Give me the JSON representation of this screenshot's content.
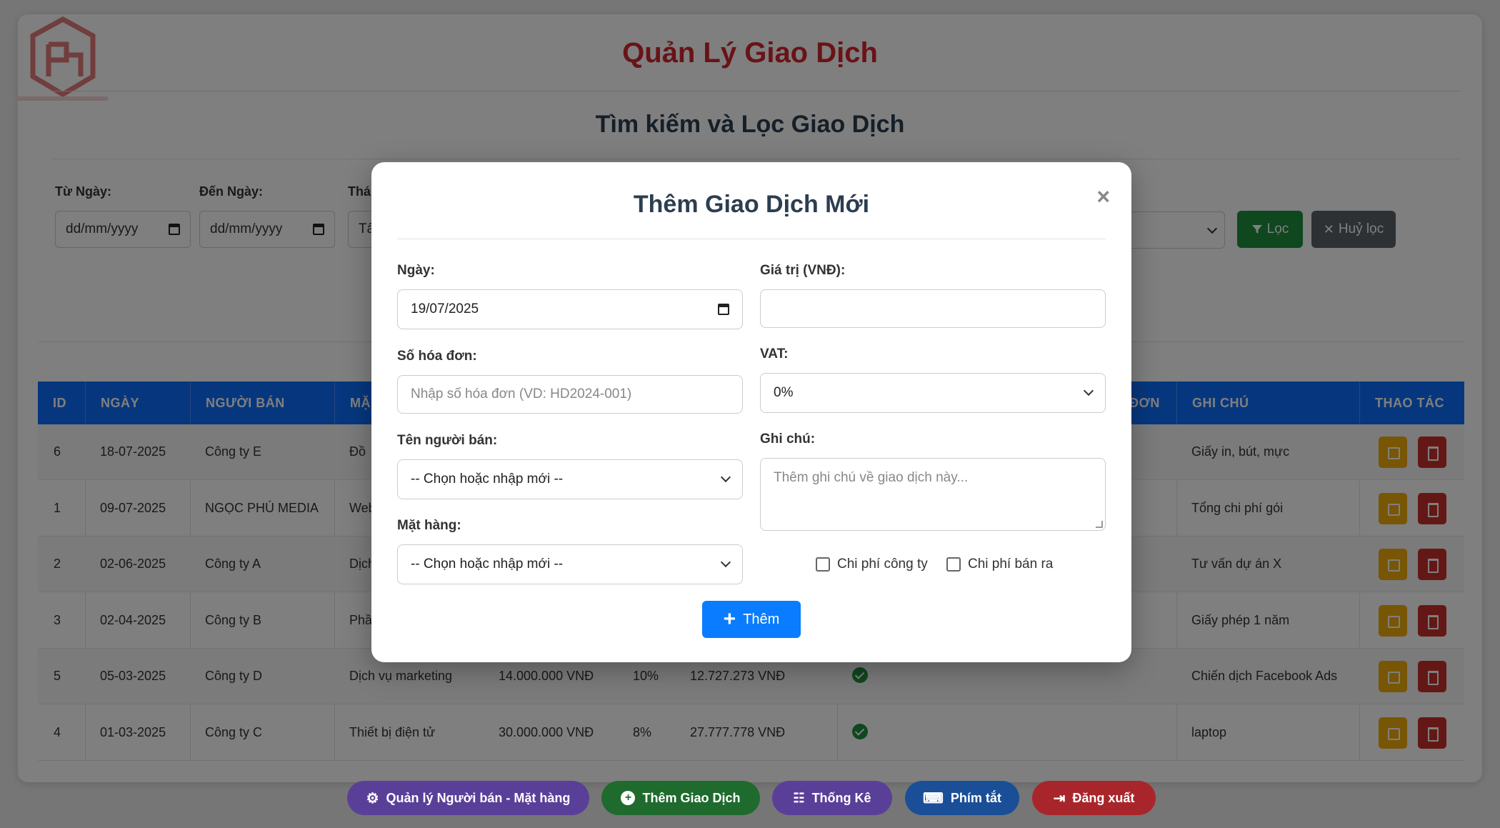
{
  "app": {
    "title": "Quản Lý Giao Dịch"
  },
  "filter": {
    "title": "Tìm kiếm và Lọc Giao Dịch",
    "from_label": "Từ Ngày:",
    "from_value": "dd/mm/yyyy",
    "to_label": "Đến Ngày:",
    "to_value": "dd/mm/yyyy",
    "third_label": "Thá",
    "third_value": "Tấ",
    "filter_button": "Lọc",
    "clear_button": "Huỷ lọc"
  },
  "table": {
    "headers": [
      "ID",
      "NGÀY",
      "NGƯỜI BÁN",
      "MẶ",
      "ĐƠN",
      "GHI CHÚ",
      "THAO TÁC"
    ],
    "rows": [
      {
        "id": "6",
        "date": "18-07-2025",
        "seller": "Công ty E",
        "item": "Đồ",
        "price": "",
        "vat": "",
        "net": "",
        "checked": false,
        "note": "Giấy in, bút, mực"
      },
      {
        "id": "1",
        "date": "09-07-2025",
        "seller": "NGỌC PHÚ MEDIA",
        "item": "Web",
        "price": "",
        "vat": "",
        "net": "",
        "checked": false,
        "note": "Tổng chi phí gói"
      },
      {
        "id": "2",
        "date": "02-06-2025",
        "seller": "Công ty A",
        "item": "Dịch",
        "price": "",
        "vat": "",
        "net": "",
        "checked": false,
        "note": "Tư vấn dự án X"
      },
      {
        "id": "3",
        "date": "02-04-2025",
        "seller": "Công ty B",
        "item": "Phầ",
        "price": "",
        "vat": "",
        "net": "",
        "checked": false,
        "note": "Giấy phép 1 năm"
      },
      {
        "id": "5",
        "date": "05-03-2025",
        "seller": "Công ty D",
        "item": "Dịch vụ marketing",
        "price": "14.000.000 VNĐ",
        "vat": "10%",
        "net": "12.727.273 VNĐ",
        "checked": true,
        "note": "Chiến dịch Facebook Ads"
      },
      {
        "id": "4",
        "date": "01-03-2025",
        "seller": "Công ty C",
        "item": "Thiết bị điện tử",
        "price": "30.000.000 VNĐ",
        "vat": "8%",
        "net": "27.777.778 VNĐ",
        "checked": true,
        "note": "laptop"
      }
    ]
  },
  "modal": {
    "title": "Thêm Giao Dịch Mới",
    "close": "×",
    "date_label": "Ngày:",
    "date_value": "19/07/2025",
    "value_label": "Giá trị (VNĐ):",
    "value_value": "",
    "invoice_label": "Số hóa đơn:",
    "invoice_placeholder": "Nhập số hóa đơn (VD: HD2024-001)",
    "vat_label": "VAT:",
    "vat_value": "0%",
    "seller_label": "Tên người bán:",
    "seller_value": "-- Chọn hoặc nhập mới --",
    "note_label": "Ghi chú:",
    "note_placeholder": "Thêm ghi chú về giao dịch này...",
    "item_label": "Mặt hàng:",
    "item_value": "-- Chọn hoặc nhập mới --",
    "cb_company": "Chi phí công ty",
    "cb_sale": "Chi phí bán ra",
    "add_button": "Thêm"
  },
  "bottom_nav": {
    "manage": "Quản lý Người bán - Mặt hàng",
    "add": "Thêm Giao Dịch",
    "stats": "Thống Kê",
    "shortcuts": "Phím tắt",
    "logout": "Đăng xuất"
  },
  "colors": {
    "title_red": "#d3272f",
    "header_blue": "#0d6efd",
    "add_blue": "#0a7cff",
    "green": "#1e8e3e",
    "purple": "#6f42c1",
    "blue": "#1565c0",
    "red": "#e53935"
  }
}
